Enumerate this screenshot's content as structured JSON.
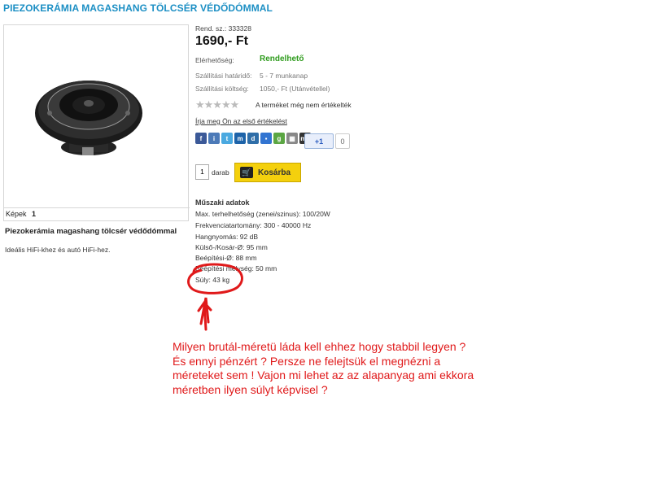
{
  "product": {
    "title": "PIEZOKERÁMIA MAGASHANG TÖLCSÉR VÉDŐDÓMMAL",
    "order_label": "Rend. sz.: 333328",
    "price": "1690,- Ft",
    "availability_label": "Elérhetőség:",
    "availability_value": "Rendelhető",
    "delivery_time_label": "Szállítási határidő:",
    "delivery_time_value": "5 - 7 munkanap",
    "shipping_cost_label": "Szállítási költség:",
    "shipping_cost_value": "1050,- Ft (Utánvétellel)",
    "rating_text": "A terméket még nem értékelték",
    "rating_stars_filled": 0,
    "rating_stars_total": 5,
    "write_review": "Írja meg Ön az első értékelést",
    "plus_label": "+1",
    "plus_count": "0",
    "qty": "1",
    "qty_unit": "darab",
    "cart_button": "Kosárba",
    "images_label": "Képek",
    "images_page": "1",
    "name": "Piezokerámia magashang tölcsér védődómmal",
    "description": "Ideális HiFi-khez és autó HiFi-hez."
  },
  "socials": [
    {
      "icon": "facebook-icon",
      "color": "#3b5998",
      "glyph": "f"
    },
    {
      "icon": "iwiw-icon",
      "color": "#4c7ab8",
      "glyph": "i"
    },
    {
      "icon": "twitter-icon",
      "color": "#4aa9e0",
      "glyph": "t"
    },
    {
      "icon": "myspace-icon",
      "color": "#1d63a9",
      "glyph": "m"
    },
    {
      "icon": "digg-icon",
      "color": "#2f6ea8",
      "glyph": "d"
    },
    {
      "icon": "delicious-icon",
      "color": "#3274d1",
      "glyph": "▪"
    },
    {
      "icon": "google-bookmark-icon",
      "color": "#5ba643",
      "glyph": "g"
    },
    {
      "icon": "share-grid-icon",
      "color": "#888888",
      "glyph": "▦"
    },
    {
      "icon": "mixx-icon",
      "color": "#333333",
      "glyph": "my"
    }
  ],
  "specs": {
    "title": "Műszaki adatok",
    "lines": [
      "Max. terhelhetőség (zenei/szinus): 100/20W",
      "Frekvenciatartomány: 300 - 40000 Hz",
      "Hangnyomás: 92 dB",
      "Külső-/Kosár-Ø: 95 mm",
      "Beépítési-Ø: 88 mm",
      "Beépítési mélység: 50 mm",
      "Súly: 43 kg"
    ]
  },
  "annotation": {
    "lines": [
      "Milyen  brutál-méretü láda kell ehhez hogy stabbil legyen ?",
      "És ennyi pénzért  ? Persze ne felejtsük el megnézni a",
      "méreteket sem ! Vajon mi lehet az az alapanyag ami ekkora",
      "méretben ilyen súlyt képvisel ?"
    ],
    "color": "#e0191a"
  }
}
